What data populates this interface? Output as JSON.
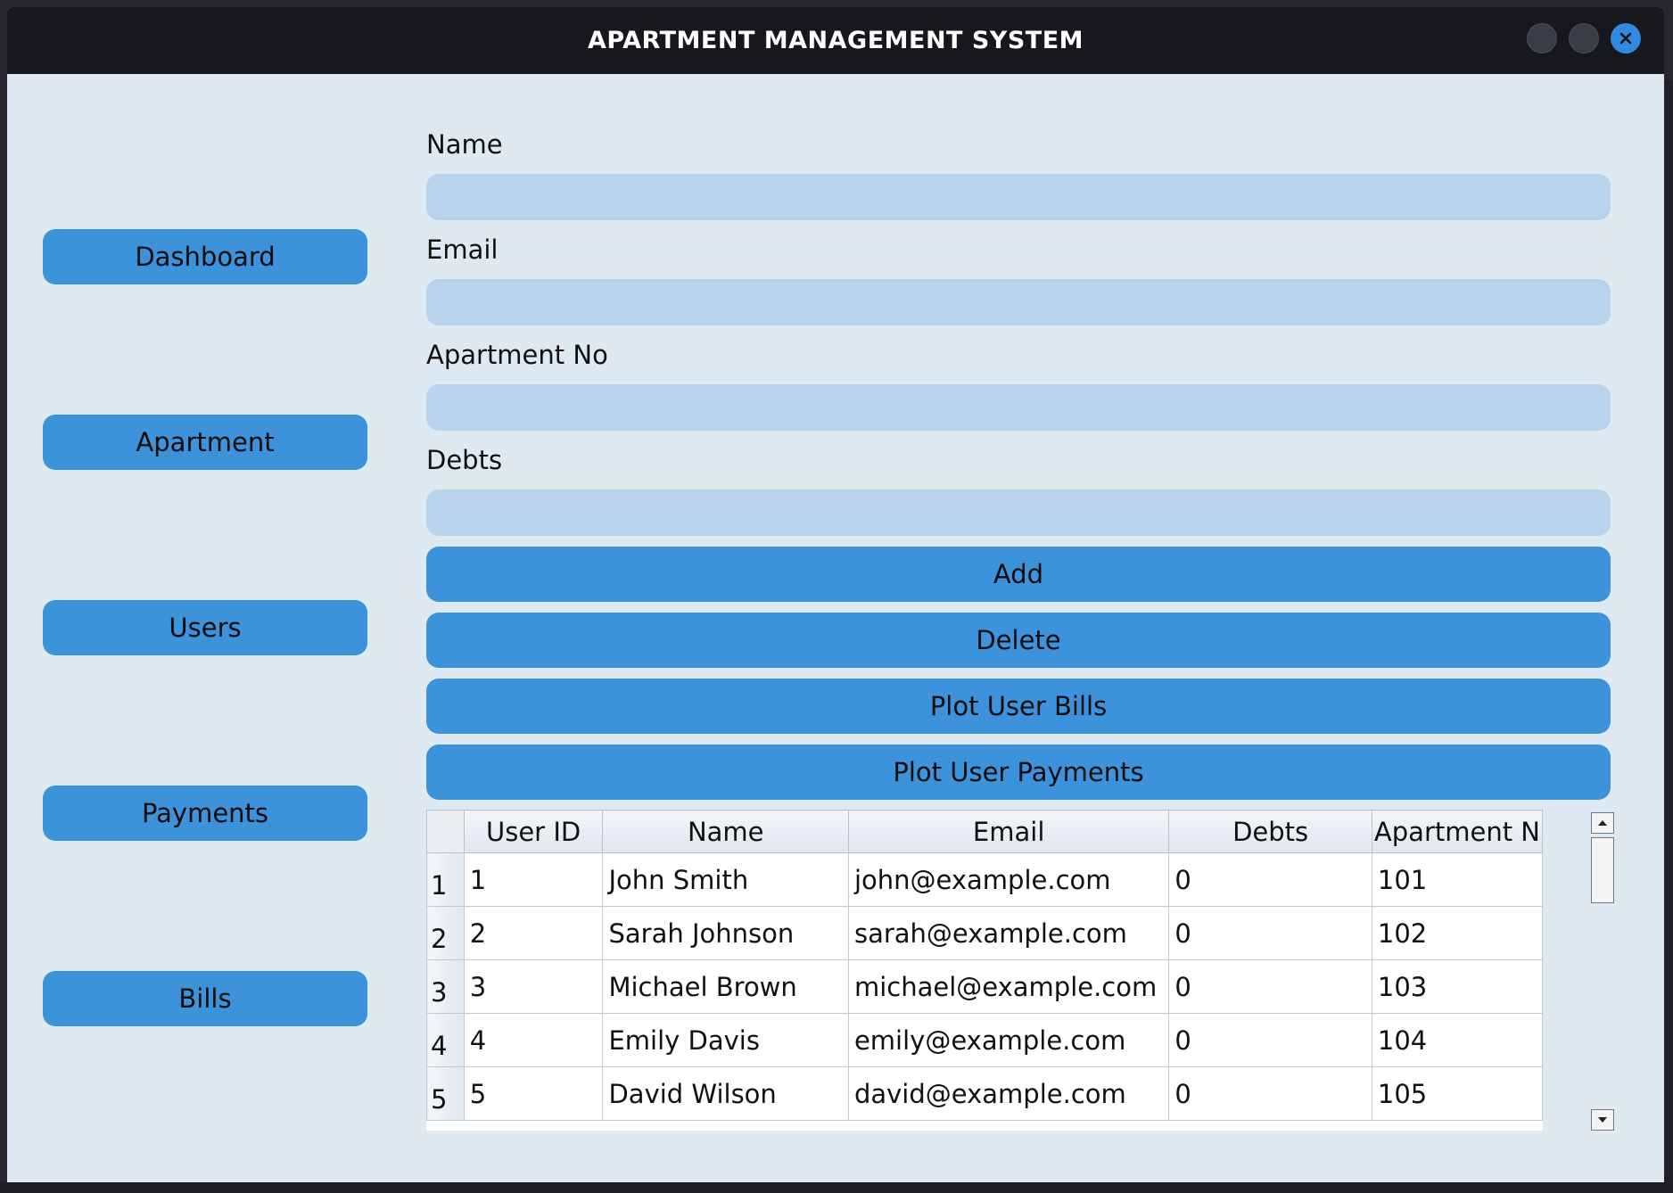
{
  "window": {
    "title": "APARTMENT MANAGEMENT SYSTEM",
    "close_color": "#2f8ae0"
  },
  "sidebar": {
    "items": [
      {
        "label": "Dashboard"
      },
      {
        "label": "Apartment"
      },
      {
        "label": "Users"
      },
      {
        "label": "Payments"
      },
      {
        "label": "Bills"
      }
    ]
  },
  "form": {
    "name_label": "Name",
    "name_value": "",
    "email_label": "Email",
    "email_value": "",
    "apartment_label": "Apartment No",
    "apartment_value": "",
    "debts_label": "Debts",
    "debts_value": ""
  },
  "actions": {
    "add": "Add",
    "delete": "Delete",
    "plot_bills": "Plot User Bills",
    "plot_payments": "Plot User Payments"
  },
  "table": {
    "columns": [
      "User ID",
      "Name",
      "Email",
      "Debts",
      "Apartment N"
    ],
    "rows": [
      {
        "num": "1",
        "cells": [
          "1",
          "John Smith",
          "john@example.com",
          "0",
          "101"
        ]
      },
      {
        "num": "2",
        "cells": [
          "2",
          "Sarah Johnson",
          "sarah@example.com",
          "0",
          "102"
        ]
      },
      {
        "num": "3",
        "cells": [
          "3",
          "Michael Brown",
          "michael@example.com",
          "0",
          "103"
        ]
      },
      {
        "num": "4",
        "cells": [
          "4",
          "Emily Davis",
          "emily@example.com",
          "0",
          "104"
        ]
      },
      {
        "num": "5",
        "cells": [
          "5",
          "David Wilson",
          "david@example.com",
          "0",
          "105"
        ]
      }
    ]
  },
  "colors": {
    "accent": "#3d93db",
    "input_bg": "#b7d4ec",
    "window_bg": "#dfe9f2",
    "titlebar_bg": "#16181d"
  }
}
